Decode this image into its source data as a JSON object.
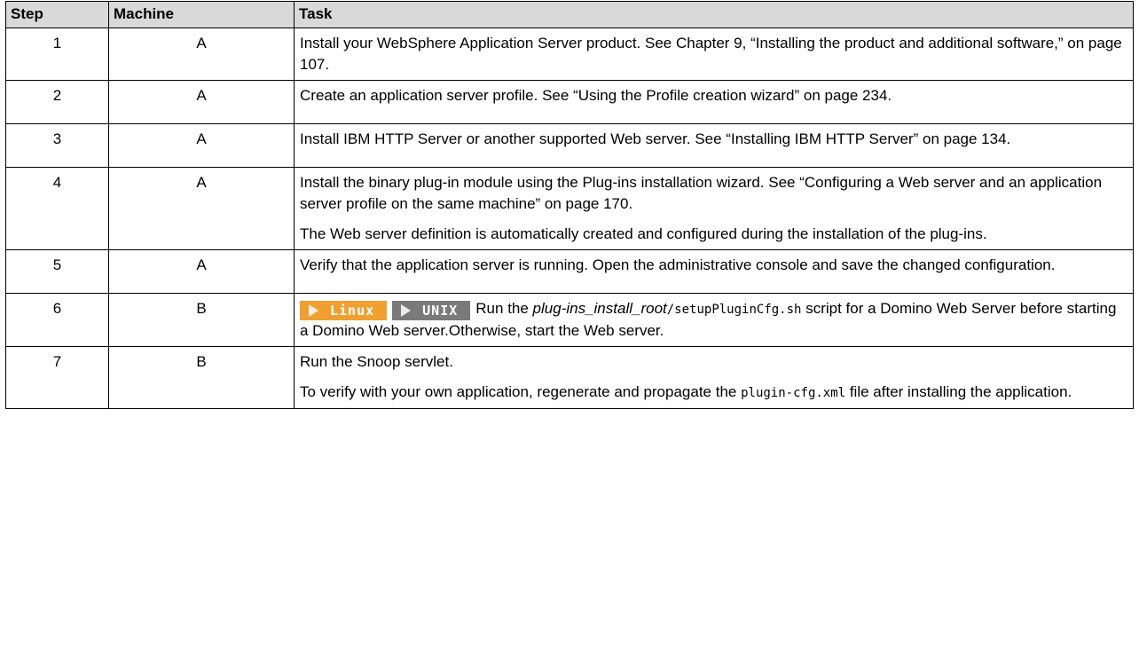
{
  "colors": {
    "header_bg": "#d9d9d9",
    "linux_badge": "#f0a030",
    "unix_badge": "#7a7a7a"
  },
  "headers": {
    "step": "Step",
    "machine": "Machine",
    "task": "Task"
  },
  "rows": [
    {
      "step": "1",
      "machine": "A",
      "task": "Install your WebSphere Application Server product. See Chapter 9, “Installing the product and additional software,” on page 107."
    },
    {
      "step": "2",
      "machine": "A",
      "task": "Create an application server profile. See “Using the Profile creation wizard” on page 234."
    },
    {
      "step": "3",
      "machine": "A",
      "task": "Install IBM HTTP Server or another supported Web server. See “Installing IBM HTTP Server” on page 134."
    },
    {
      "step": "4",
      "machine": "A",
      "task": "Install the binary plug-in module using the Plug-ins installation wizard. See “Configuring a Web server and an application server profile on the same machine” on page 170.",
      "task_note": "The Web server definition is automatically created and configured during the installation of the plug-ins."
    },
    {
      "step": "5",
      "machine": "A",
      "task": "Verify that the application server is running. Open the administrative console and save the changed configuration."
    },
    {
      "step": "6",
      "machine": "B",
      "badge_linux": "Linux",
      "badge_unix": "UNIX",
      "task_prefix": "Run the ",
      "task_path_italic": "plug-ins_install_root",
      "task_path_code": "/setupPluginCfg.sh",
      "task_suffix": " script for a Domino Web Server before starting a Domino Web server.Otherwise, start the Web server."
    },
    {
      "step": "7",
      "machine": "B",
      "task": "Run the Snoop servlet.",
      "task_note_prefix": "To verify with your own application, regenerate and propagate the ",
      "task_note_code": "plugin-cfg.xml",
      "task_note_suffix": " file after installing the application."
    }
  ]
}
